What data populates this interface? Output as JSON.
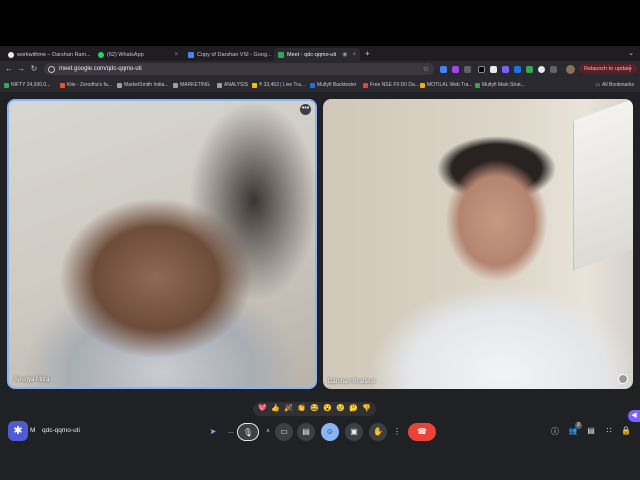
{
  "browser": {
    "tabs": [
      {
        "label": "workwithme – Darshan Ram...",
        "color": "#e8eaed"
      },
      {
        "label": "(62) WhatsApp",
        "color": "#25d366"
      },
      {
        "label": "Copy of Darshan VSI - Goog...",
        "color": "#4285f4"
      },
      {
        "label": "Meet - qdc-qqmo-uti",
        "color": "#34a853"
      }
    ],
    "new_tab": "+",
    "tab_menu": "⌄",
    "back": "←",
    "forward": "→",
    "reload": "↻",
    "url": "meet.google.com/qdc-qqmo-uti",
    "star": "☆",
    "relaunch_label": "Relaunch to update",
    "menu": "⋮",
    "extension_colors": [
      "#4285f4",
      "#a142f4",
      "#5f6368",
      "#000000",
      "#e8eaed",
      "#7b61ff",
      "#1a73e8",
      "#34a853",
      "#e8eaed",
      "#5f6368"
    ],
    "bookmarks": [
      {
        "label": "NIFTY 24,930.0...",
        "color": "#34a853"
      },
      {
        "label": "Kite - Zerodha's fa...",
        "color": "#f4511e"
      },
      {
        "label": "MarketSmith India...",
        "color": "#9aa0a6"
      },
      {
        "label": "MARKETING",
        "color": "#9aa0a6"
      },
      {
        "label": "ANALYSIS",
        "color": "#9aa0a6"
      },
      {
        "label": "₹ 33,463 | Live Tra...",
        "color": "#fbbc04"
      },
      {
        "label": "Multyfi Backtester",
        "color": "#1a73e8"
      },
      {
        "label": "Free NSE FII DII Da...",
        "color": "#ea4335"
      },
      {
        "label": "MOTILAL Web Tra...",
        "color": "#f9ab00"
      },
      {
        "label": "Multyfi Main Strat...",
        "color": "#34a853"
      }
    ],
    "all_bookmarks": "All Bookmarks"
  },
  "meet": {
    "participants": [
      {
        "name": "Anugya Mitra"
      },
      {
        "name": "Darshan Bhatiwal"
      }
    ],
    "tile_menu": "•••",
    "reactions": [
      "💖",
      "👍",
      "🎉",
      "👏",
      "😂",
      "😮",
      "😢",
      "🤔",
      "👎"
    ],
    "meeting_time": "M",
    "meeting_code": "qdc-qqmo-uti",
    "participant_count": "2",
    "controls": {
      "share": "➤",
      "more_left": "…",
      "mic": "🎙",
      "camera_arrow": "˄",
      "camera": "▭",
      "captions": "▤",
      "emoji": "☺",
      "present": "▣",
      "hand": "✋",
      "more": "⋮",
      "end_call": "☎",
      "info": "ⓘ",
      "people": "👥",
      "chat": "▤",
      "activities": "∷",
      "host": "🔒",
      "effects": "✱",
      "side": "◀"
    }
  }
}
